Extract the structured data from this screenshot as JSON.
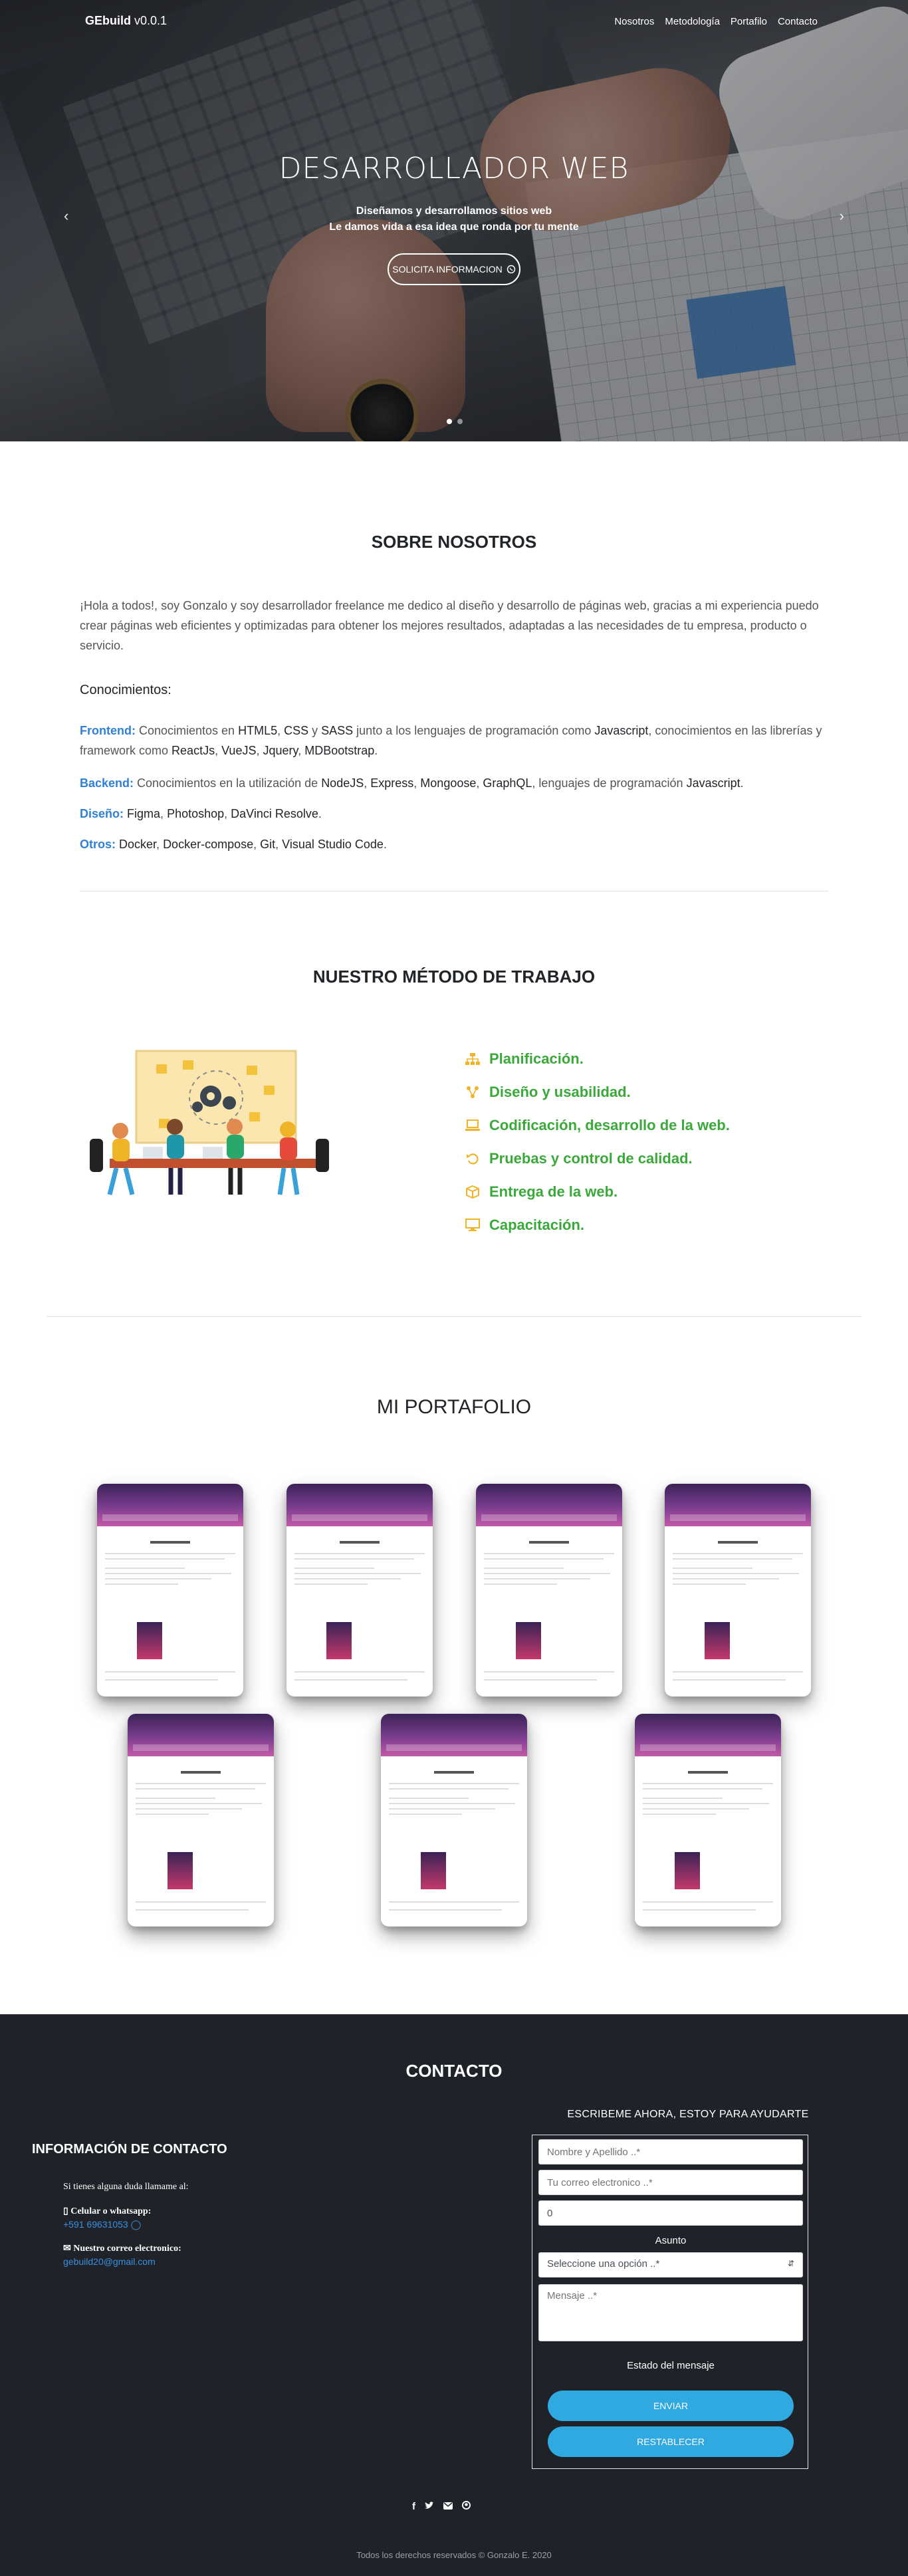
{
  "nav": {
    "brand_bold": "GEbuild",
    "brand_version": " v0.0.1",
    "links": [
      "Nosotros",
      "Metodología",
      "Portafilo",
      "Contacto"
    ]
  },
  "hero": {
    "title": "DESARROLLADOR WEB",
    "line1": "Diseñamos y desarrollamos sitios web",
    "line2": "Le damos vida a esa idea que ronda por tu mente",
    "button_label": "SOLICITA INFORMACION",
    "prev_icon": "chevron-left-icon",
    "next_icon": "chevron-right-icon",
    "slides": 2,
    "active_slide": 1
  },
  "about": {
    "title": "SOBRE NOSOTROS",
    "intro": "¡Hola a todos!, soy Gonzalo y soy desarrollador freelance me dedico al diseño y desarrollo de páginas web, gracias a mi experiencia puedo crear páginas web eficientes y optimizadas para obtener los mejores resultados, adaptadas a las necesidades de tu empresa, producto o servicio.",
    "knowledge_title": "Conocimientos:",
    "frontend": {
      "label": "Frontend:",
      "t1": " Conocimientos en ",
      "html": "HTML5",
      "c1": ", ",
      "css": "CSS",
      "t2": " y ",
      "sass": "SASS",
      "t3": " junto a los lenguajes de programación como ",
      "js": "Javascript",
      "t4": ", conocimientos en las librerías y framework como ",
      "react": "ReactJs",
      "c2": ", ",
      "vue": "VueJS",
      "c3": ", ",
      "jquery": "Jquery",
      "c4": ", ",
      "mdb": "MDBootstrap",
      "end": "."
    },
    "backend": {
      "label": "Backend:",
      "t1": " Conocimientos en la utilización de ",
      "node": "NodeJS",
      "c1": ", ",
      "express": "Express",
      "c2": ", ",
      "mongoose": "Mongoose",
      "c3": ", ",
      "graphql": "GraphQL",
      "t2": ", lenguajes de programación ",
      "js": "Javascript",
      "end": "."
    },
    "design": {
      "label": "Diseño:",
      "t1": " ",
      "figma": "Figma",
      "c1": ", ",
      "ps": "Photoshop",
      "c2": ", ",
      "dv": "DaVinci Resolve",
      "end": "."
    },
    "others": {
      "label": "Otros:",
      "t1": " ",
      "docker": "Docker",
      "c1": ", ",
      "compose": "Docker-compose",
      "c2": ", ",
      "git": "Git",
      "c3": ", ",
      "vsc": "Visual Studio Code",
      "end": "."
    }
  },
  "method": {
    "title": "NUESTRO MÉTODO DE TRABAJO",
    "items": [
      {
        "icon": "sitemap-icon",
        "label": "Planificación."
      },
      {
        "icon": "share-nodes-icon",
        "label": "Diseño y usabilidad."
      },
      {
        "icon": "laptop-icon",
        "label": "Codificación, desarrollo de la web."
      },
      {
        "icon": "undo-icon",
        "label": "Pruebas y control de calidad."
      },
      {
        "icon": "box-icon",
        "label": "Entrega de la web."
      },
      {
        "icon": "desktop-icon",
        "label": "Capacitación."
      }
    ],
    "colors": {
      "text": "#3aa93a",
      "icon": "#f0b429"
    }
  },
  "portfolio": {
    "title": "MI PORTAFOLIO",
    "cards": 7
  },
  "contact": {
    "title": "CONTACTO",
    "info_title": "INFORMACIÓN DE CONTACTO",
    "call_text": "Si tienes alguna duda llamame al:",
    "phone_label": "Celular o whatsapp:",
    "phone_value": "+591 69631053",
    "email_label": "Nuestro correo electronico:",
    "email_value": "gebuild20@gmail.com",
    "form_caption": "ESCRIBEME AHORA, ESTOY PARA AYUDARTE",
    "name_placeholder": "Nombre y Apellido ..*",
    "email_placeholder": "Tu correo electronico ..*",
    "number_value": "0",
    "subject_label": "Asunto",
    "subject_selected": "Seleccione una opción ..*",
    "message_placeholder": "Mensaje ..*",
    "status_label": "Estado del mensaje",
    "send_label": "ENVIAR",
    "reset_label": "RESTABLECER",
    "social_icons": [
      "facebook-icon",
      "twitter-icon",
      "mail-icon",
      "github-icon"
    ],
    "copyright": "Todos los derechos reservados © Gonzalo E. 2020",
    "colors": {
      "background": "#1f2329",
      "accent": "#2fa9e0",
      "link": "#3a90e0"
    }
  }
}
